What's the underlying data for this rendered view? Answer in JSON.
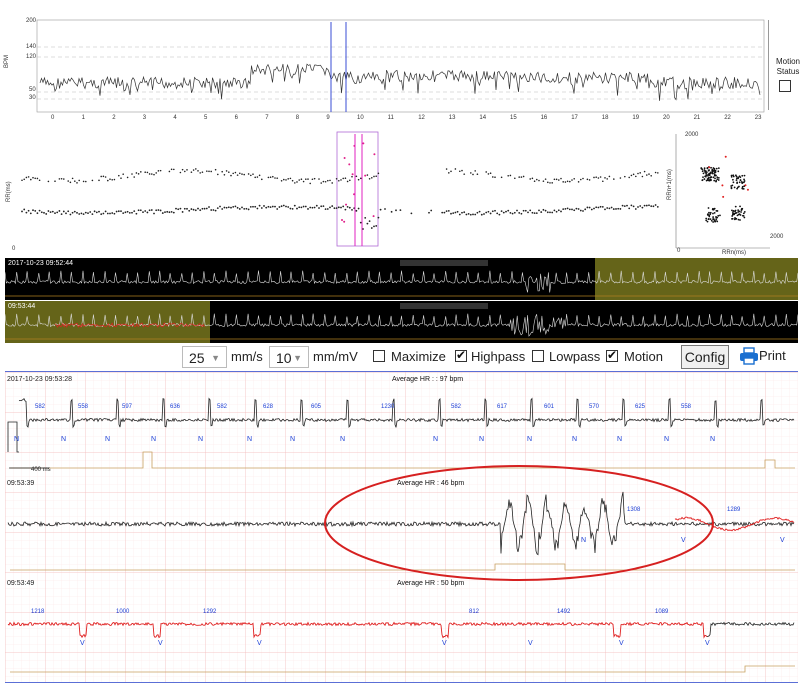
{
  "trend": {
    "y_ticks": [
      "200",
      "140",
      "120",
      "50",
      "30"
    ],
    "y_axis_label": "BPM",
    "x_ticks": [
      "0",
      "1",
      "2",
      "3",
      "4",
      "5",
      "6",
      "7",
      "8",
      "9",
      "10",
      "11",
      "12",
      "13",
      "14",
      "15",
      "16",
      "17",
      "18",
      "19",
      "20",
      "21",
      "22",
      "23"
    ],
    "motion_status_label": "Motion\nStatus"
  },
  "scatter": {
    "rr_axis_label": "RR(ms)",
    "left_zero": "0",
    "lorenz_y_max": "2000",
    "lorenz_x_max": "2000",
    "lorenz_zero": "0",
    "lorenz_y_label": "RRn+1(ms)",
    "lorenz_x_label": "RRn(ms)"
  },
  "strip1": {
    "timestamp": "2017-10-23 09:52:44"
  },
  "strip2": {
    "timestamp": "09:53:44"
  },
  "toolbar": {
    "speed_value": "25",
    "speed_unit": "mm/s",
    "gain_value": "10",
    "gain_unit": "mm/mV",
    "maximize_label": "Maximize",
    "maximize_checked": false,
    "highpass_label": "Highpass",
    "highpass_checked": true,
    "lowpass_label": "Lowpass",
    "lowpass_checked": false,
    "motion_label": "Motion",
    "motion_checked": true,
    "config_label": "Config",
    "print_label": "Print"
  },
  "ecg": {
    "scale_label": "400 ms",
    "rows": [
      {
        "timestamp": "2017-10-23 09:53:28",
        "avg_hr": "Average HR : : 97 bpm",
        "rr_labels": [
          "582",
          "558",
          "597",
          "636",
          "582",
          "628",
          "605",
          "1230",
          "582",
          "617",
          "601",
          "570",
          "625",
          "558"
        ],
        "beat_labels": [
          "N",
          "N",
          "N",
          "N",
          "N",
          "N",
          "N",
          "N",
          "N",
          "N",
          "N",
          "N",
          "N",
          "N",
          "N"
        ]
      },
      {
        "timestamp": "09:53:39",
        "avg_hr": "Average HR : 46 bpm",
        "rr_labels": [
          "1308",
          "1289"
        ],
        "beat_labels": [
          "N",
          "V",
          "V",
          "V"
        ]
      },
      {
        "timestamp": "09:53:49",
        "avg_hr": "Average HR : 50 bpm",
        "rr_labels": [
          "1218",
          "1000",
          "1292",
          "812",
          "1492",
          "1089"
        ],
        "beat_labels": [
          "V",
          "V",
          "V",
          "V",
          "V",
          "V",
          "V"
        ]
      }
    ]
  },
  "colors": {
    "grid_major": "#f2b8b8",
    "grid_minor": "#fbe3e3",
    "ecg_trace": "#222222",
    "ecg_abnormal": "#e02020",
    "annotation_blue": "#1c3fd6",
    "highlight_circle": "#d62020",
    "strip_highlight": "#6e6d1b"
  }
}
